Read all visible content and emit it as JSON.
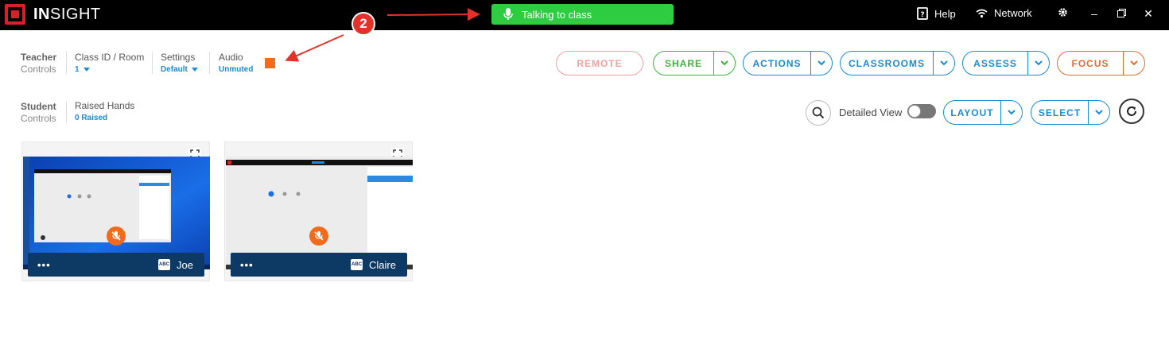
{
  "app": {
    "logo_bold": "IN",
    "logo_rest": "SIGHT"
  },
  "topbar": {
    "talk_label": "Talking to class",
    "help_label": "Help",
    "network_label": "Network"
  },
  "teacher_controls": {
    "title": "Teacher",
    "subtitle": "Controls",
    "class_id": {
      "label": "Class ID / Room",
      "value": "1"
    },
    "settings": {
      "label": "Settings",
      "value": "Default"
    },
    "audio": {
      "label": "Audio",
      "value": "Unmuted"
    }
  },
  "student_controls": {
    "title": "Student",
    "subtitle": "Controls",
    "raised_hands": {
      "label": "Raised Hands",
      "value": "0 Raised"
    }
  },
  "toolbar": {
    "remote": "REMOTE",
    "share": "SHARE",
    "actions": "ACTIONS",
    "classrooms": "CLASSROOMS",
    "assess": "ASSESS",
    "focus": "FOCUS",
    "detailed_view": "Detailed View",
    "layout": "LAYOUT",
    "select": "SELECT"
  },
  "students": [
    {
      "name": "Joe",
      "abc": "ABC",
      "menu": "•••"
    },
    {
      "name": "Claire",
      "abc": "ABC",
      "menu": "•••"
    }
  ],
  "annotation": {
    "step": "2"
  },
  "colors": {
    "talk_green": "#2ecc40",
    "accent_blue": "#1a8bd6",
    "share_green": "#3db53d",
    "focus_orange": "#e8692e",
    "remote_pink": "#f0a0a0",
    "mute_orange": "#f26b1d",
    "name_bar_navy": "#0d3a64",
    "annotation_red": "#e2332a"
  }
}
